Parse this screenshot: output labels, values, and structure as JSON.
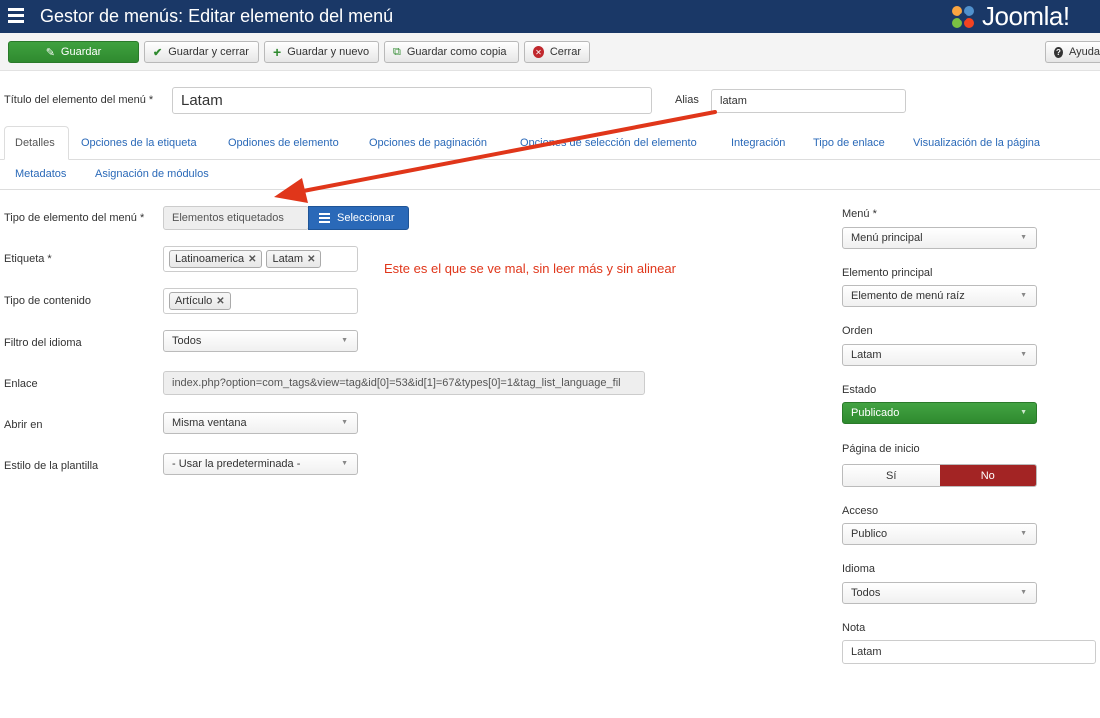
{
  "header": {
    "title": "Gestor de menús: Editar elemento del menú",
    "logo_text": "Joomla!"
  },
  "toolbar": {
    "save": "Guardar",
    "save_close": "Guardar y cerrar",
    "save_new": "Guardar y nuevo",
    "save_copy": "Guardar como copia",
    "close": "Cerrar",
    "help": "Ayuda"
  },
  "title_row": {
    "title_label": "Título del elemento del menú *",
    "title_value": "Latam",
    "alias_label": "Alias",
    "alias_value": "latam"
  },
  "tabs": [
    "Detalles",
    "Opciones de la etiqueta",
    "Opdiones de elemento",
    "Opciones de paginación",
    "Opciones de selección del elemento",
    "Integración",
    "Tipo de enlace",
    "Visualización de la página",
    "Metadatos",
    "Asignación de módulos"
  ],
  "form": {
    "type_label": "Tipo de elemento del menú *",
    "type_value": "Elementos etiquetados",
    "select_button": "Seleccionar",
    "tag_label": "Etiqueta *",
    "tags": [
      "Latinoamerica",
      "Latam"
    ],
    "content_type_label": "Tipo de contenido",
    "content_types": [
      "Artículo"
    ],
    "language_filter_label": "Filtro del idioma",
    "language_filter_value": "Todos",
    "link_label": "Enlace",
    "link_value": "index.php?option=com_tags&view=tag&id[0]=53&id[1]=67&types[0]=1&tag_list_language_fil",
    "open_in_label": "Abrir en",
    "open_in_value": "Misma ventana",
    "template_style_label": "Estilo de la plantilla",
    "template_style_value": "- Usar la predeterminada -"
  },
  "annotation": {
    "text": "Este es el que se ve mal, sin leer más y sin alinear",
    "color": "#e0361a"
  },
  "sidebar": {
    "menu_label": "Menú *",
    "menu_value": "Menú principal",
    "parent_label": "Elemento principal",
    "parent_value": "Elemento de menú raíz",
    "order_label": "Orden",
    "order_value": "Latam",
    "status_label": "Estado",
    "status_value": "Publicado",
    "home_label": "Página de inicio",
    "home_yes": "Sí",
    "home_no": "No",
    "access_label": "Acceso",
    "access_value": "Publico",
    "language_label": "Idioma",
    "language_value": "Todos",
    "note_label": "Nota",
    "note_value": "Latam"
  },
  "colors": {
    "header_bg": "#1a3867",
    "save_green": "#2f8a2f",
    "link_blue": "#2a69b8",
    "no_red": "#a32424"
  }
}
